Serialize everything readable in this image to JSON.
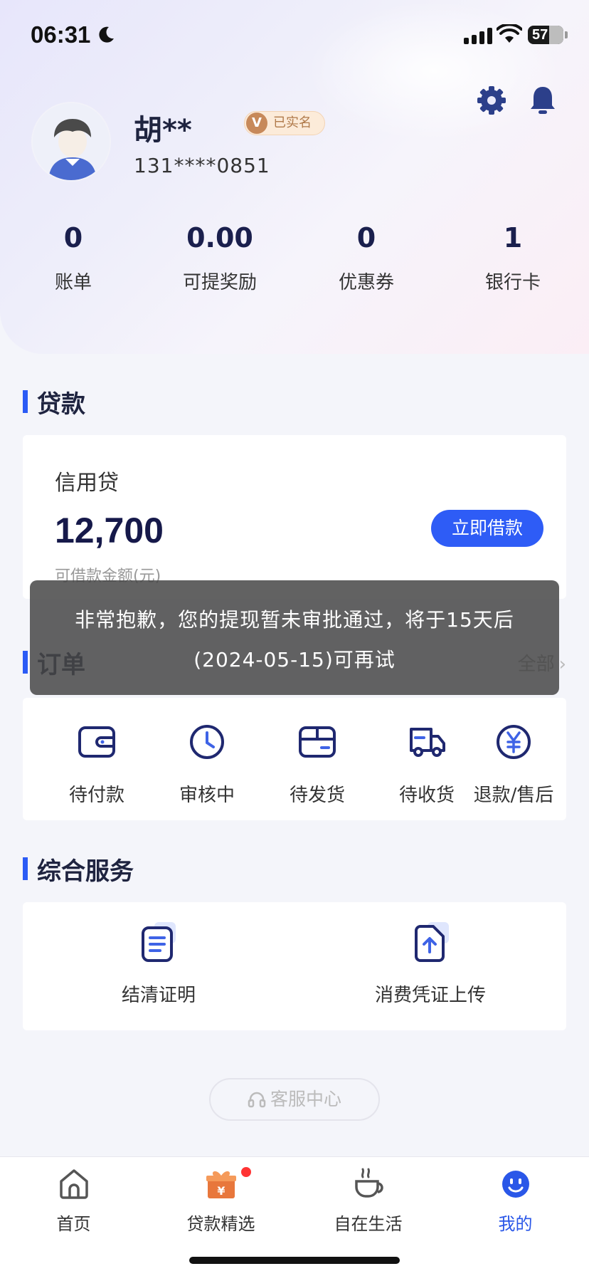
{
  "status_bar": {
    "time": "06:31",
    "battery": "57"
  },
  "profile": {
    "name": "胡**",
    "verified_badge": "已实名",
    "verified_mark": "V",
    "phone": "131****0851"
  },
  "stats": [
    {
      "value": "0",
      "label": "账单"
    },
    {
      "value": "0.00",
      "label": "可提奖励"
    },
    {
      "value": "0",
      "label": "优惠券"
    },
    {
      "value": "1",
      "label": "银行卡"
    }
  ],
  "loan": {
    "section_title": "贷款",
    "type": "信用贷",
    "amount": "12,700",
    "amount_label": "可借款金额(元)",
    "button": "立即借款"
  },
  "orders": {
    "section_title": "订单",
    "all_label": "全部",
    "items": [
      {
        "label": "待付款",
        "icon": "wallet-icon"
      },
      {
        "label": "审核中",
        "icon": "clock-icon"
      },
      {
        "label": "待发货",
        "icon": "package-icon"
      },
      {
        "label": "待收货",
        "icon": "truck-icon"
      },
      {
        "label": "退款/售后",
        "icon": "yuan-icon"
      }
    ]
  },
  "services": {
    "section_title": "综合服务",
    "items": [
      {
        "label": "结清证明",
        "icon": "document-icon"
      },
      {
        "label": "消费凭证上传",
        "icon": "upload-document-icon"
      }
    ]
  },
  "customer_service": {
    "label": "客服中心"
  },
  "toast": {
    "line1": "非常抱歉，您的提现暂未审批通过，将于15天后",
    "line2": "(2024-05-15)可再试"
  },
  "tabbar": [
    {
      "label": "首页",
      "icon": "home-icon"
    },
    {
      "label": "贷款精选",
      "icon": "gift-icon"
    },
    {
      "label": "自在生活",
      "icon": "coffee-icon"
    },
    {
      "label": "我的",
      "icon": "smiley-icon",
      "active": true
    }
  ],
  "colors": {
    "accent": "#2e5cf6",
    "tab_active": "#2a57e8",
    "toast_bg": "#464646"
  }
}
